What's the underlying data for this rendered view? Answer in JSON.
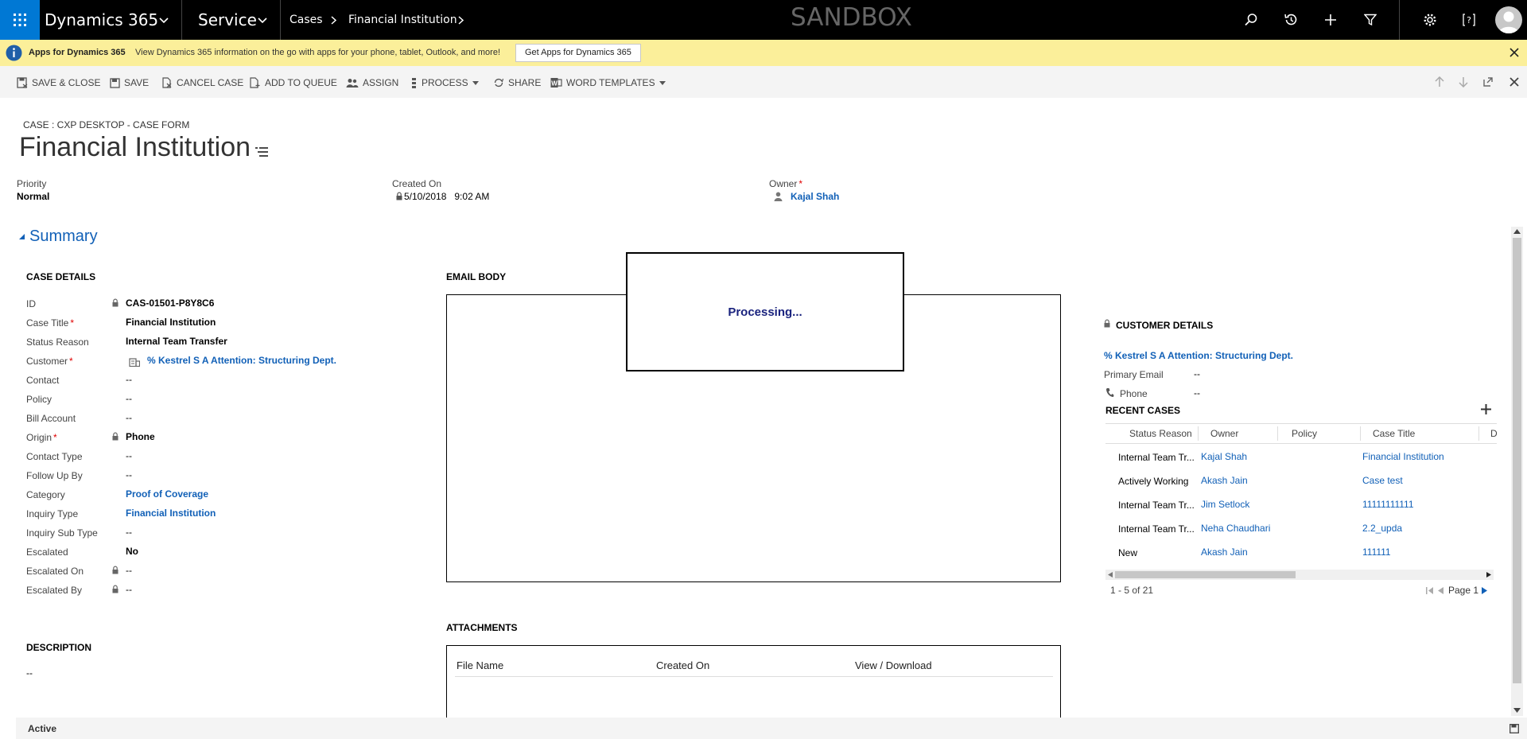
{
  "topnav": {
    "app_name": "Dynamics 365",
    "area": "Service",
    "breadcrumb_entity": "Cases",
    "breadcrumb_record": "Financial Institution",
    "environment": "SANDBOX"
  },
  "banner": {
    "title": "Apps for Dynamics 365",
    "message": "View Dynamics 365 information on the go with apps for your phone, tablet, Outlook, and more!",
    "button_label": "Get Apps for Dynamics 365"
  },
  "commands": {
    "save_close": "SAVE & CLOSE",
    "save": "SAVE",
    "cancel_case": "CANCEL CASE",
    "add_to_queue": "ADD TO QUEUE",
    "assign": "ASSIGN",
    "process": "PROCESS",
    "share": "SHARE",
    "word_templates": "WORD TEMPLATES"
  },
  "form": {
    "entity_form": "CASE : CXP DESKTOP - CASE FORM",
    "title": "Financial Institution",
    "header": {
      "priority_label": "Priority",
      "priority_value": "Normal",
      "created_on_label": "Created On",
      "created_on_value": "5/10/2018   9:02 AM",
      "owner_label": "Owner",
      "owner_value": "Kajal Shah"
    },
    "summary_label": "Summary"
  },
  "case_details": {
    "heading": "CASE DETAILS",
    "fields": [
      {
        "label": "ID",
        "value": "CAS-01501-P8Y8C6"
      },
      {
        "label": "Case Title",
        "value": "Financial Institution"
      },
      {
        "label": "Status Reason",
        "value": "Internal Team Transfer"
      },
      {
        "label": "Customer",
        "value": "% Kestrel S A Attention: Structuring Dept."
      },
      {
        "label": "Contact",
        "value": "--"
      },
      {
        "label": "Policy",
        "value": "--"
      },
      {
        "label": "Bill Account",
        "value": "--"
      },
      {
        "label": "Origin",
        "value": "Phone"
      },
      {
        "label": "Contact Type",
        "value": "--"
      },
      {
        "label": "Follow Up By",
        "value": "--"
      },
      {
        "label": "Category",
        "value": "Proof of Coverage"
      },
      {
        "label": "Inquiry Type",
        "value": "Financial Institution"
      },
      {
        "label": "Inquiry Sub Type",
        "value": "--"
      },
      {
        "label": "Escalated",
        "value": "No"
      },
      {
        "label": "Escalated On",
        "value": "--"
      },
      {
        "label": "Escalated By",
        "value": "--"
      }
    ]
  },
  "description": {
    "heading": "DESCRIPTION",
    "value": "--"
  },
  "email_body": {
    "heading": "EMAIL BODY",
    "processing_text": "Processing..."
  },
  "attachments": {
    "heading": "ATTACHMENTS",
    "columns": [
      "File Name",
      "Created On",
      "View / Download"
    ]
  },
  "customer_details": {
    "heading": "CUSTOMER DETAILS",
    "customer_name": "% Kestrel S A Attention: Structuring Dept.",
    "primary_email_label": "Primary Email",
    "primary_email_value": "--",
    "phone_label": "Phone",
    "phone_value": "--"
  },
  "recent_cases": {
    "heading": "RECENT CASES",
    "columns": [
      "Status Reason",
      "Owner",
      "Policy",
      "Case Title",
      "D"
    ],
    "rows": [
      {
        "status": "Internal Team Tr...",
        "owner": "Kajal Shah",
        "policy": "",
        "title": "Financial Institution"
      },
      {
        "status": "Actively Working",
        "owner": "Akash Jain",
        "policy": "",
        "title": "Case test"
      },
      {
        "status": "Internal Team Tr...",
        "owner": "Jim Setlock",
        "policy": "",
        "title": "11111111111"
      },
      {
        "status": "Internal Team Tr...",
        "owner": "Neha Chaudhari",
        "policy": "",
        "title": "2.2_upda"
      },
      {
        "status": "New",
        "owner": "Akash Jain",
        "policy": "",
        "title": "111111"
      }
    ],
    "paging_summary": "1 - 5 of 21",
    "page_label": "Page 1"
  },
  "status_bar": {
    "status": "Active"
  },
  "colors": {
    "accent": "#0078d4",
    "link": "#1160b7",
    "banner": "#fbef9a",
    "required": "#e00000"
  }
}
